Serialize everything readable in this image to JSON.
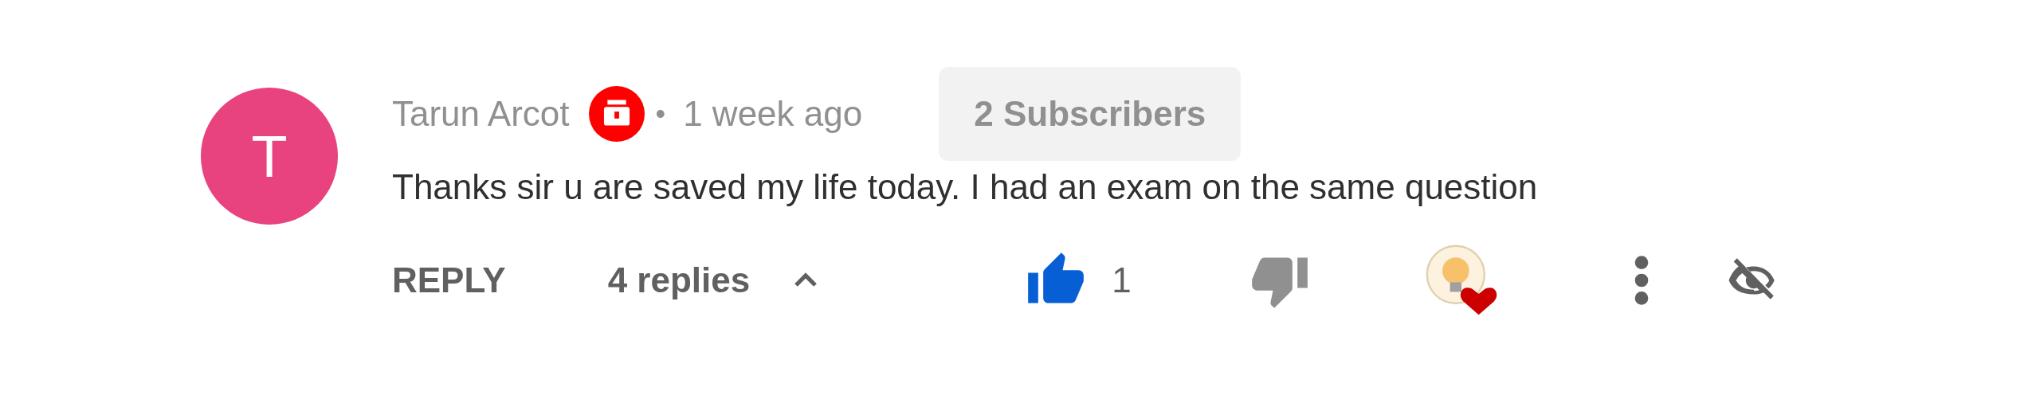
{
  "comment": {
    "avatar_letter": "T",
    "author": "Tarun Arcot",
    "separator": "•",
    "time": "1 week ago",
    "subscribers": "2 Subscribers",
    "text": "Thanks sir u are saved my life today. I had an exam on the same question"
  },
  "actions": {
    "reply": "REPLY",
    "replies": {
      "label": "4 replies",
      "expanded": true
    },
    "like": {
      "selected": true,
      "count": "1"
    },
    "dislike": {
      "selected": false
    },
    "hearted": true
  }
}
